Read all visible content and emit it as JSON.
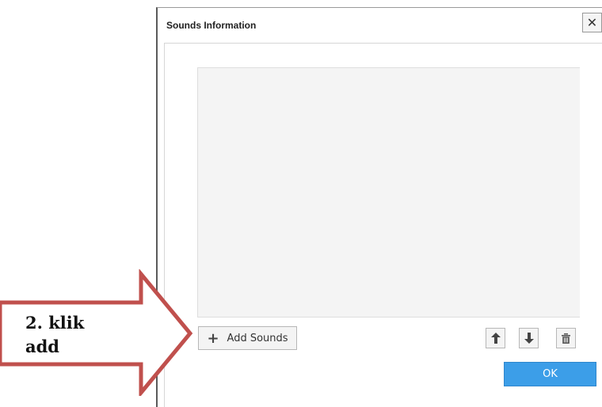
{
  "dialog": {
    "title": "Sounds Information",
    "close_symbol": "✕",
    "add_sounds_label": "Add Sounds",
    "add_icon": "plus-icon",
    "up_icon": "arrow-up-icon",
    "down_icon": "arrow-down-icon",
    "delete_icon": "trash-icon",
    "ok_label": "OK"
  },
  "annotation": {
    "text": "2. klik add",
    "arrow_color": "#c0504d"
  },
  "colors": {
    "ok_button": "#3c9ee8",
    "list_background": "#f4f4f4"
  }
}
